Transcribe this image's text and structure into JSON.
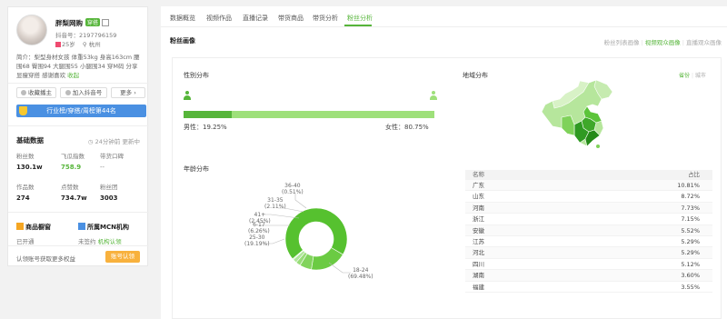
{
  "profile": {
    "name": "胖梨网购",
    "tag": "穿搭",
    "douyin_id": "抖音号：2197796159",
    "age": "25岁",
    "location": "杭州",
    "bio_lines": [
      "简介：梨型身材女孩 体重53kg 身高163cm 腰",
      "围68 臀围94 大腿围55 小腿围34 穿M码 分享",
      "显瘦穿搭 感谢喜欢"
    ],
    "bio_follow": "收起"
  },
  "actions": {
    "collect": "收藏播主",
    "add": "加入抖音号",
    "more": "更多"
  },
  "rank": "行业榜/穿搭/周榜第44名",
  "basic": {
    "title": "基础数据",
    "refresh": "24分钟前  更新中",
    "stats": [
      {
        "label": "粉丝数",
        "value": "130.1w"
      },
      {
        "label": "飞瓜指数",
        "value": "758.9"
      },
      {
        "label": "带货口碑",
        "value": "--"
      },
      {
        "label": "作品数",
        "value": "274"
      },
      {
        "label": "点赞数",
        "value": "734.7w"
      },
      {
        "label": "粉丝团",
        "value": "3003"
      }
    ]
  },
  "showcase": {
    "title": "商品橱窗",
    "status": "已开通"
  },
  "mcn": {
    "title": "所属MCN机构",
    "status": "未签约",
    "link": "机构认领"
  },
  "claim": {
    "text": "认领账号获取更多权益",
    "button": "账号认领"
  },
  "tabs": [
    "数据概览",
    "视频作品",
    "直播记录",
    "带货商品",
    "带货分析",
    "粉丝分析"
  ],
  "section_title": "粉丝画像",
  "subtabs": [
    "粉丝列表画像",
    "视频观众画像",
    "直播观众画像"
  ],
  "gender": {
    "title": "性别分布",
    "male_label": "男性：19.25%",
    "female_label": "女性：80.75%",
    "male_ratio": 19.25,
    "female_ratio": 80.75
  },
  "age": {
    "title": "年龄分布",
    "labels": [
      {
        "range": "36-40",
        "pct": "(0.51%)"
      },
      {
        "range": "31-35",
        "pct": "(2.11%)"
      },
      {
        "range": "41+",
        "pct": "(2.45%)"
      },
      {
        "range": "6-17",
        "pct": "(6.26%)"
      },
      {
        "range": "25-30",
        "pct": "(19.19%)"
      },
      {
        "range": "18-24",
        "pct": "(69.48%)"
      }
    ]
  },
  "region": {
    "title": "地域分布",
    "toggle": [
      "省份",
      "城市"
    ],
    "header": {
      "name": "名称",
      "ratio": "占比"
    },
    "rows": [
      {
        "name": "广东",
        "ratio": "10.81%"
      },
      {
        "name": "山东",
        "ratio": "8.72%"
      },
      {
        "name": "河南",
        "ratio": "7.73%"
      },
      {
        "name": "浙江",
        "ratio": "7.15%"
      },
      {
        "name": "安徽",
        "ratio": "5.52%"
      },
      {
        "name": "江苏",
        "ratio": "5.29%"
      },
      {
        "name": "河北",
        "ratio": "5.29%"
      },
      {
        "name": "四川",
        "ratio": "5.12%"
      },
      {
        "name": "湖南",
        "ratio": "3.60%"
      },
      {
        "name": "福建",
        "ratio": "3.55%"
      }
    ]
  },
  "colors": {
    "accent": "#56b53a",
    "female": "#9ee07a",
    "rank": "#4a90e2",
    "claim": "#f8b13d"
  }
}
